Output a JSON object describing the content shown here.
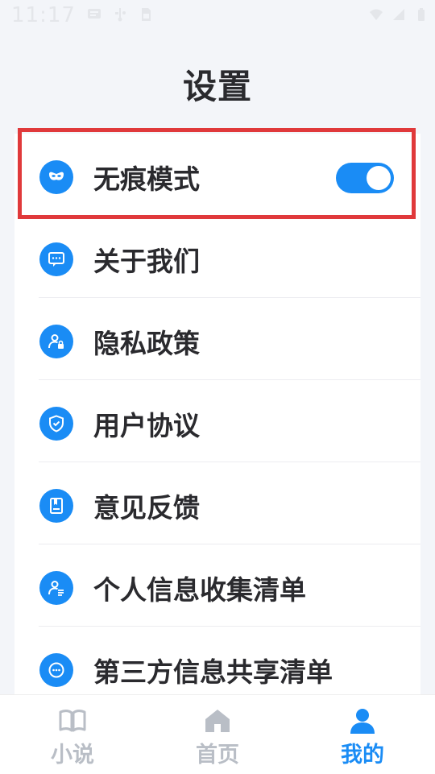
{
  "status_bar": {
    "time": "11:17",
    "left_icons": [
      "message-icon",
      "usb-icon",
      "sim-icon"
    ],
    "right_icons": [
      "wifi-icon",
      "signal-icon",
      "battery-icon"
    ]
  },
  "page": {
    "title": "设置"
  },
  "settings": {
    "items": [
      {
        "label": "无痕模式",
        "icon": "mask-icon",
        "toggle": true
      },
      {
        "label": "关于我们",
        "icon": "chat-icon"
      },
      {
        "label": "隐私政策",
        "icon": "user-lock-icon"
      },
      {
        "label": "用户协议",
        "icon": "shield-check-icon"
      },
      {
        "label": "意见反馈",
        "icon": "book-icon"
      },
      {
        "label": "个人信息收集清单",
        "icon": "user-list-icon"
      },
      {
        "label": "第三方信息共享清单",
        "icon": "chat-dots-icon"
      }
    ]
  },
  "tabs": [
    {
      "label": "小说",
      "icon": "book-open-icon",
      "active": false
    },
    {
      "label": "首页",
      "icon": "home-icon",
      "active": false
    },
    {
      "label": "我的",
      "icon": "person-icon",
      "active": true
    }
  ],
  "colors": {
    "accent": "#1a8cf5",
    "highlight": "#e0393b",
    "background": "#f3f5f9",
    "inactive_tab": "#b9bec6"
  }
}
